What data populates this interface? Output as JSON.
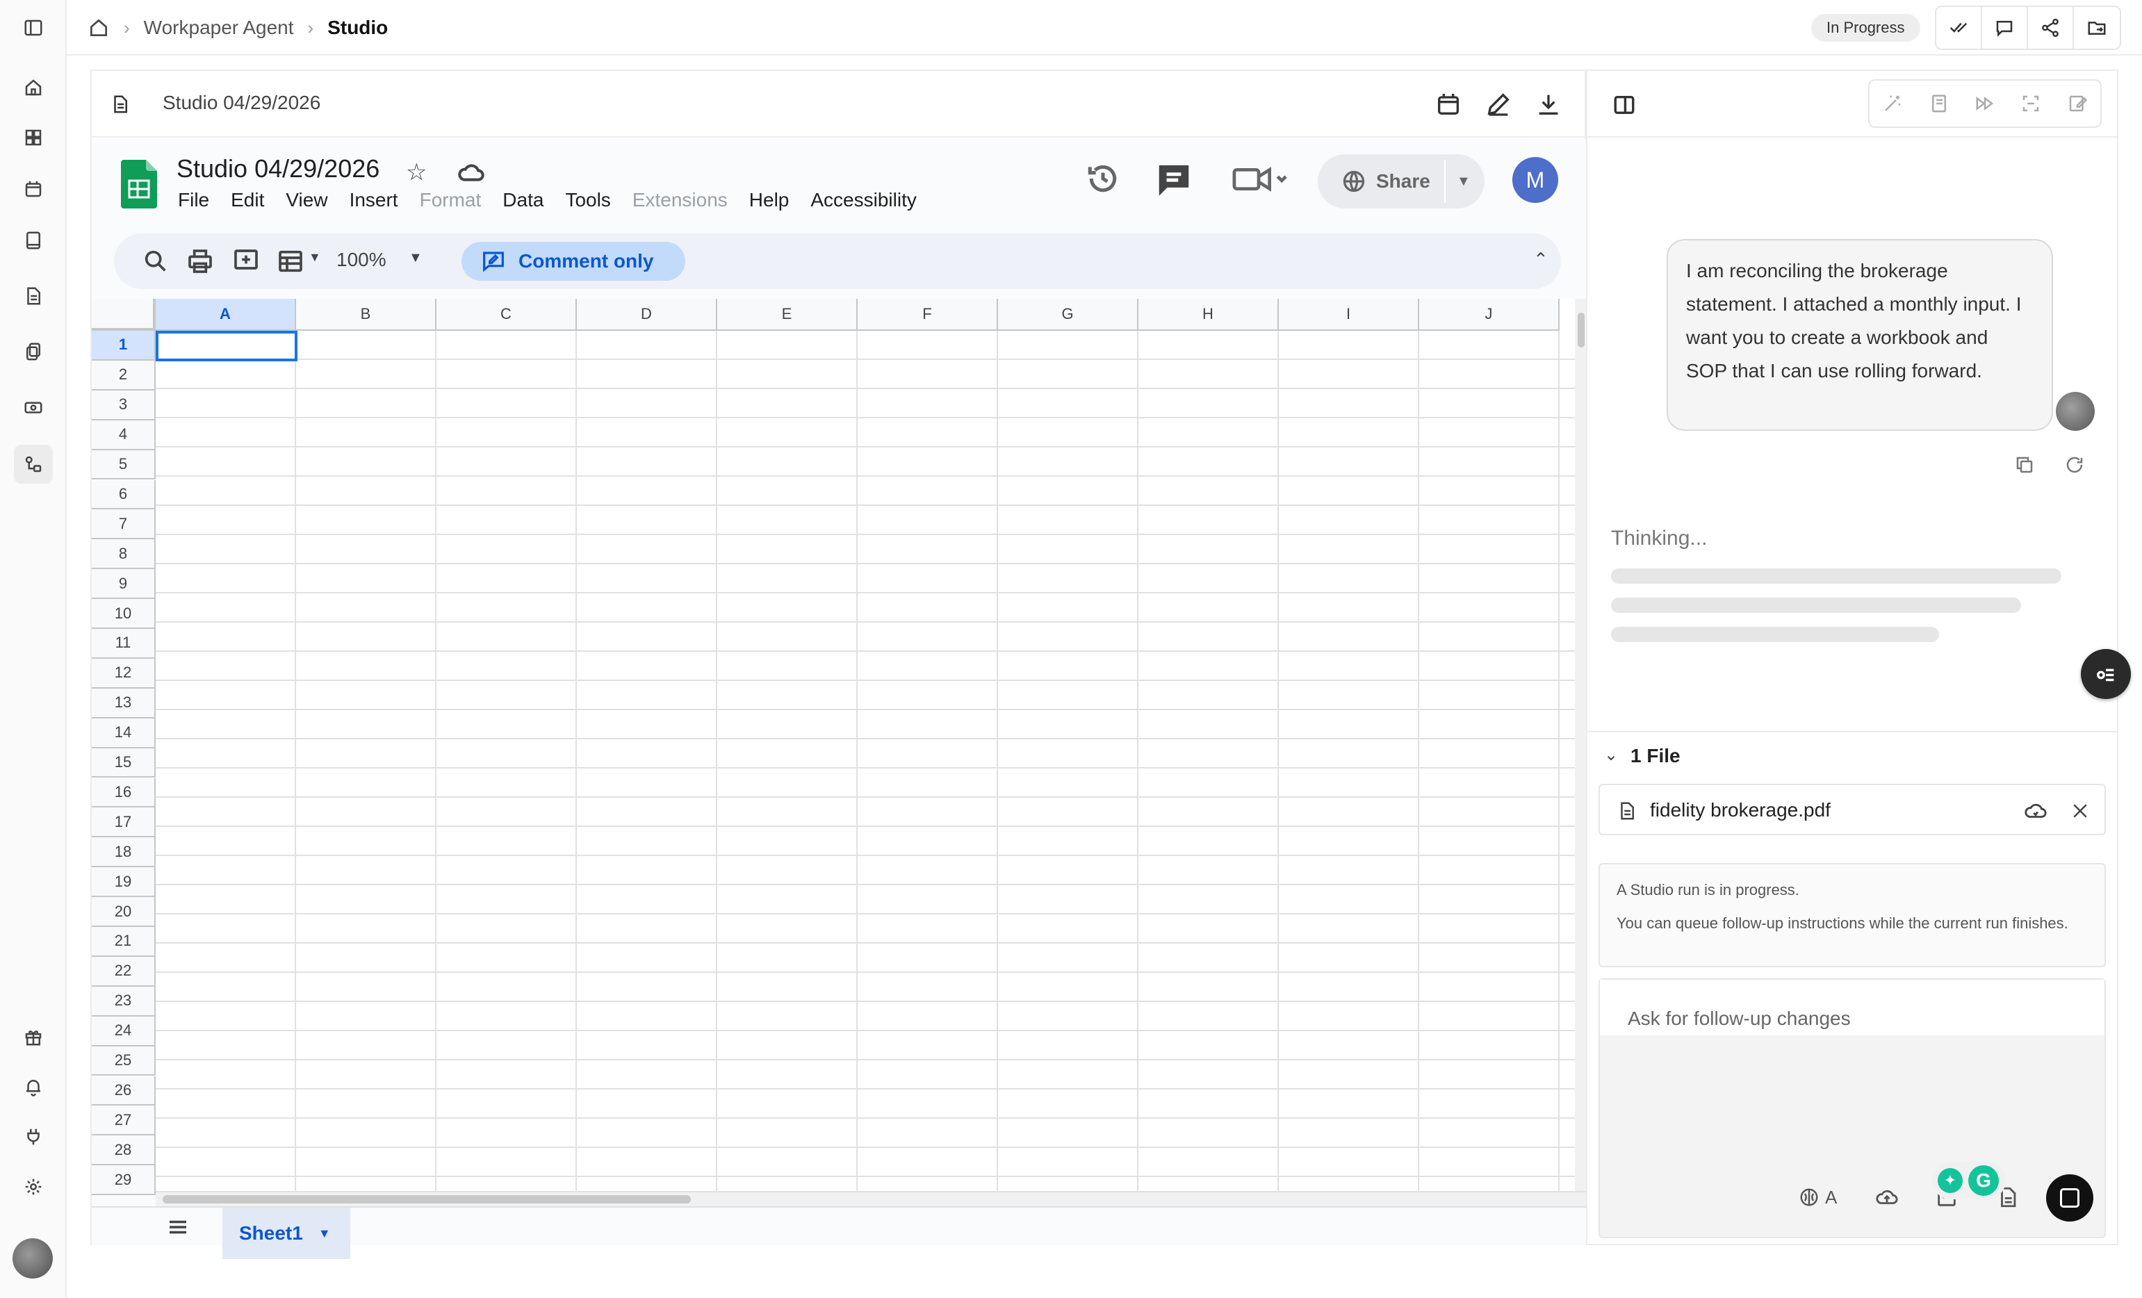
{
  "breadcrumb": {
    "items": [
      "Workpaper Agent",
      "Studio"
    ]
  },
  "status": "In Progress",
  "document": {
    "title": "Studio 04/29/2026"
  },
  "sheets": {
    "title": "Studio 04/29/2026",
    "menu": [
      "File",
      "Edit",
      "View",
      "Insert",
      "Format",
      "Data",
      "Tools",
      "Extensions",
      "Help",
      "Accessibility"
    ],
    "share_label": "Share",
    "avatar_initial": "M",
    "zoom": "100%",
    "mode_label": "Comment only",
    "columns": [
      "A",
      "B",
      "C",
      "D",
      "E",
      "F",
      "G",
      "H",
      "I",
      "J"
    ],
    "rows": [
      "1",
      "2",
      "3",
      "4",
      "5",
      "6",
      "7",
      "8",
      "9",
      "10",
      "11",
      "12",
      "13",
      "14",
      "15",
      "16",
      "17",
      "18",
      "19",
      "20",
      "21",
      "22",
      "23",
      "24",
      "25",
      "26",
      "27",
      "28",
      "29"
    ],
    "selected_cell": "A1",
    "sheet_tab": "Sheet1"
  },
  "chat": {
    "user_message": "I am reconciling the brokerage statement. I attached a monthly input. I want you to create a workbook and SOP that I can use rolling forward.",
    "thinking_label": "Thinking...",
    "files_header": "1 File",
    "file_name": "fidelity brokerage.pdf",
    "run_note_line1": "A Studio run is in progress.",
    "run_note_line2": "You can queue follow-up instructions while the current run finishes.",
    "composer_placeholder": "Ask for follow-up changes",
    "model_label": "A"
  },
  "colors": {
    "accent_blue": "#0b57d0",
    "sheets_green": "#0f9d58",
    "avatar_blue": "#4d6ec9"
  }
}
